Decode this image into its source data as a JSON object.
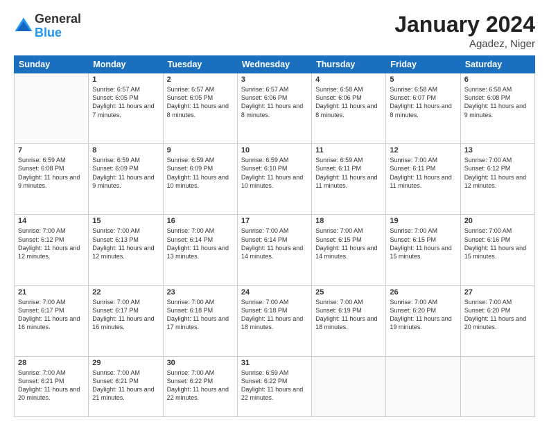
{
  "header": {
    "logo": {
      "general": "General",
      "blue": "Blue"
    },
    "month_year": "January 2024",
    "location": "Agadez, Niger"
  },
  "weekdays": [
    "Sunday",
    "Monday",
    "Tuesday",
    "Wednesday",
    "Thursday",
    "Friday",
    "Saturday"
  ],
  "weeks": [
    [
      {
        "num": "",
        "sunrise": "",
        "sunset": "",
        "daylight": ""
      },
      {
        "num": "1",
        "sunrise": "Sunrise: 6:57 AM",
        "sunset": "Sunset: 6:05 PM",
        "daylight": "Daylight: 11 hours and 7 minutes."
      },
      {
        "num": "2",
        "sunrise": "Sunrise: 6:57 AM",
        "sunset": "Sunset: 6:05 PM",
        "daylight": "Daylight: 11 hours and 8 minutes."
      },
      {
        "num": "3",
        "sunrise": "Sunrise: 6:57 AM",
        "sunset": "Sunset: 6:06 PM",
        "daylight": "Daylight: 11 hours and 8 minutes."
      },
      {
        "num": "4",
        "sunrise": "Sunrise: 6:58 AM",
        "sunset": "Sunset: 6:06 PM",
        "daylight": "Daylight: 11 hours and 8 minutes."
      },
      {
        "num": "5",
        "sunrise": "Sunrise: 6:58 AM",
        "sunset": "Sunset: 6:07 PM",
        "daylight": "Daylight: 11 hours and 8 minutes."
      },
      {
        "num": "6",
        "sunrise": "Sunrise: 6:58 AM",
        "sunset": "Sunset: 6:08 PM",
        "daylight": "Daylight: 11 hours and 9 minutes."
      }
    ],
    [
      {
        "num": "7",
        "sunrise": "Sunrise: 6:59 AM",
        "sunset": "Sunset: 6:08 PM",
        "daylight": "Daylight: 11 hours and 9 minutes."
      },
      {
        "num": "8",
        "sunrise": "Sunrise: 6:59 AM",
        "sunset": "Sunset: 6:09 PM",
        "daylight": "Daylight: 11 hours and 9 minutes."
      },
      {
        "num": "9",
        "sunrise": "Sunrise: 6:59 AM",
        "sunset": "Sunset: 6:09 PM",
        "daylight": "Daylight: 11 hours and 10 minutes."
      },
      {
        "num": "10",
        "sunrise": "Sunrise: 6:59 AM",
        "sunset": "Sunset: 6:10 PM",
        "daylight": "Daylight: 11 hours and 10 minutes."
      },
      {
        "num": "11",
        "sunrise": "Sunrise: 6:59 AM",
        "sunset": "Sunset: 6:11 PM",
        "daylight": "Daylight: 11 hours and 11 minutes."
      },
      {
        "num": "12",
        "sunrise": "Sunrise: 7:00 AM",
        "sunset": "Sunset: 6:11 PM",
        "daylight": "Daylight: 11 hours and 11 minutes."
      },
      {
        "num": "13",
        "sunrise": "Sunrise: 7:00 AM",
        "sunset": "Sunset: 6:12 PM",
        "daylight": "Daylight: 11 hours and 12 minutes."
      }
    ],
    [
      {
        "num": "14",
        "sunrise": "Sunrise: 7:00 AM",
        "sunset": "Sunset: 6:12 PM",
        "daylight": "Daylight: 11 hours and 12 minutes."
      },
      {
        "num": "15",
        "sunrise": "Sunrise: 7:00 AM",
        "sunset": "Sunset: 6:13 PM",
        "daylight": "Daylight: 11 hours and 12 minutes."
      },
      {
        "num": "16",
        "sunrise": "Sunrise: 7:00 AM",
        "sunset": "Sunset: 6:14 PM",
        "daylight": "Daylight: 11 hours and 13 minutes."
      },
      {
        "num": "17",
        "sunrise": "Sunrise: 7:00 AM",
        "sunset": "Sunset: 6:14 PM",
        "daylight": "Daylight: 11 hours and 14 minutes."
      },
      {
        "num": "18",
        "sunrise": "Sunrise: 7:00 AM",
        "sunset": "Sunset: 6:15 PM",
        "daylight": "Daylight: 11 hours and 14 minutes."
      },
      {
        "num": "19",
        "sunrise": "Sunrise: 7:00 AM",
        "sunset": "Sunset: 6:15 PM",
        "daylight": "Daylight: 11 hours and 15 minutes."
      },
      {
        "num": "20",
        "sunrise": "Sunrise: 7:00 AM",
        "sunset": "Sunset: 6:16 PM",
        "daylight": "Daylight: 11 hours and 15 minutes."
      }
    ],
    [
      {
        "num": "21",
        "sunrise": "Sunrise: 7:00 AM",
        "sunset": "Sunset: 6:17 PM",
        "daylight": "Daylight: 11 hours and 16 minutes."
      },
      {
        "num": "22",
        "sunrise": "Sunrise: 7:00 AM",
        "sunset": "Sunset: 6:17 PM",
        "daylight": "Daylight: 11 hours and 16 minutes."
      },
      {
        "num": "23",
        "sunrise": "Sunrise: 7:00 AM",
        "sunset": "Sunset: 6:18 PM",
        "daylight": "Daylight: 11 hours and 17 minutes."
      },
      {
        "num": "24",
        "sunrise": "Sunrise: 7:00 AM",
        "sunset": "Sunset: 6:18 PM",
        "daylight": "Daylight: 11 hours and 18 minutes."
      },
      {
        "num": "25",
        "sunrise": "Sunrise: 7:00 AM",
        "sunset": "Sunset: 6:19 PM",
        "daylight": "Daylight: 11 hours and 18 minutes."
      },
      {
        "num": "26",
        "sunrise": "Sunrise: 7:00 AM",
        "sunset": "Sunset: 6:20 PM",
        "daylight": "Daylight: 11 hours and 19 minutes."
      },
      {
        "num": "27",
        "sunrise": "Sunrise: 7:00 AM",
        "sunset": "Sunset: 6:20 PM",
        "daylight": "Daylight: 11 hours and 20 minutes."
      }
    ],
    [
      {
        "num": "28",
        "sunrise": "Sunrise: 7:00 AM",
        "sunset": "Sunset: 6:21 PM",
        "daylight": "Daylight: 11 hours and 20 minutes."
      },
      {
        "num": "29",
        "sunrise": "Sunrise: 7:00 AM",
        "sunset": "Sunset: 6:21 PM",
        "daylight": "Daylight: 11 hours and 21 minutes."
      },
      {
        "num": "30",
        "sunrise": "Sunrise: 7:00 AM",
        "sunset": "Sunset: 6:22 PM",
        "daylight": "Daylight: 11 hours and 22 minutes."
      },
      {
        "num": "31",
        "sunrise": "Sunrise: 6:59 AM",
        "sunset": "Sunset: 6:22 PM",
        "daylight": "Daylight: 11 hours and 22 minutes."
      },
      {
        "num": "",
        "sunrise": "",
        "sunset": "",
        "daylight": ""
      },
      {
        "num": "",
        "sunrise": "",
        "sunset": "",
        "daylight": ""
      },
      {
        "num": "",
        "sunrise": "",
        "sunset": "",
        "daylight": ""
      }
    ]
  ]
}
